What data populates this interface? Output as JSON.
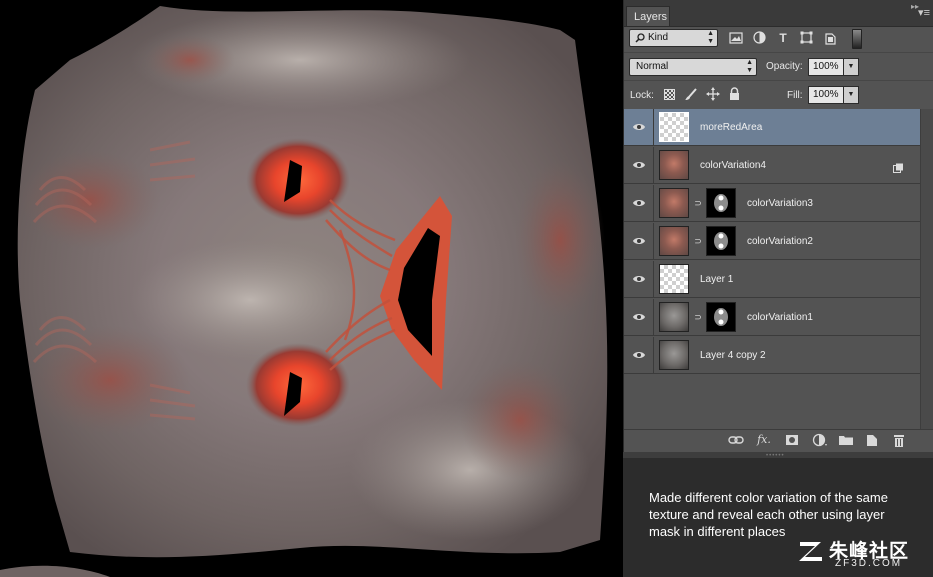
{
  "panel": {
    "tab_label": "Layers",
    "filter": {
      "kind_label": "Kind"
    },
    "blend_mode": "Normal",
    "opacity_label": "Opacity:",
    "opacity_value": "100%",
    "lock_label": "Lock:",
    "fill_label": "Fill:",
    "fill_value": "100%"
  },
  "layers": [
    {
      "name": "moreRedArea",
      "visible": true,
      "selected": true,
      "thumb": "transparent",
      "mask": false,
      "smart_object": false
    },
    {
      "name": "colorVariation4",
      "visible": true,
      "selected": false,
      "thumb": "texture",
      "mask": false,
      "smart_object": true
    },
    {
      "name": "colorVariation3",
      "visible": true,
      "selected": false,
      "thumb": "texture",
      "mask": true,
      "smart_object": false
    },
    {
      "name": "colorVariation2",
      "visible": true,
      "selected": false,
      "thumb": "texture",
      "mask": true,
      "smart_object": false
    },
    {
      "name": "Layer 1",
      "visible": true,
      "selected": false,
      "thumb": "transparent",
      "mask": false,
      "smart_object": false
    },
    {
      "name": "colorVariation1",
      "visible": true,
      "selected": false,
      "thumb": "texture-grey",
      "mask": true,
      "smart_object": false
    },
    {
      "name": "Layer 4 copy 2",
      "visible": true,
      "selected": false,
      "thumb": "texture-grey",
      "mask": false,
      "smart_object": false
    }
  ],
  "bottom_bar_icons": [
    "link-layers-icon",
    "fx-icon",
    "add-mask-icon",
    "adjustment-layer-icon",
    "new-group-icon",
    "new-layer-icon",
    "delete-icon"
  ],
  "caption": "Made different color variation of the same texture and reveal each other using layer mask in different places",
  "watermark": {
    "chinese": "朱峰社区",
    "site": "ZF3D.COM"
  },
  "colors": {
    "selected_row": "#6d7f95",
    "panel_bg": "#535353",
    "caption_bg": "#2c2c2c",
    "eye_glow": "#ff5a3c"
  }
}
